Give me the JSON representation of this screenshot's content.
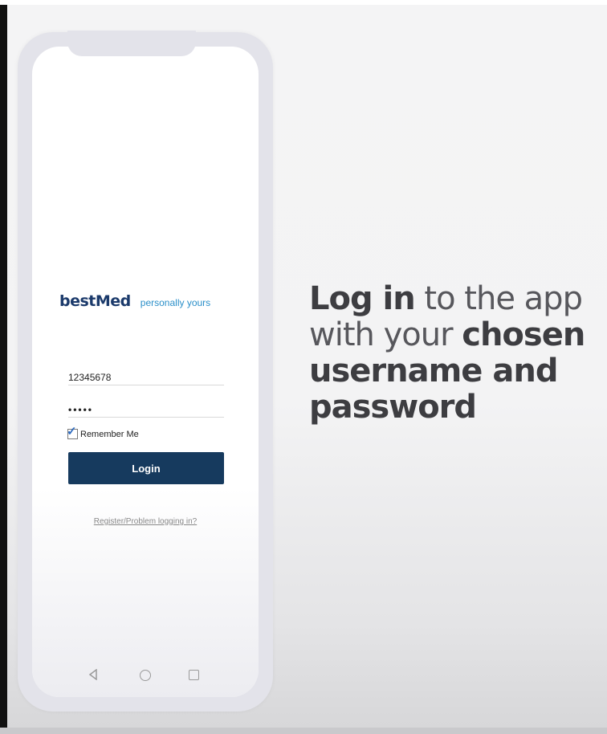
{
  "app": {
    "brand_name": "bestMed",
    "brand_tagline": "personally yours"
  },
  "login_form": {
    "username_value": "12345678",
    "password_value": "•••••",
    "remember_me_label": "Remember Me",
    "remember_me_checked": true,
    "login_button_label": "Login",
    "help_link_label": "Register/Problem logging in?"
  },
  "nav_icons": [
    "back-icon",
    "home-icon",
    "recent-apps-icon"
  ],
  "caption": {
    "part1": "Log in",
    "part2": " to the app with your ",
    "part3": "chosen username and password"
  },
  "colors": {
    "brand_navy": "#1b3a6b",
    "tagline_blue": "#2a8fc9",
    "button_navy": "#163a5e"
  }
}
